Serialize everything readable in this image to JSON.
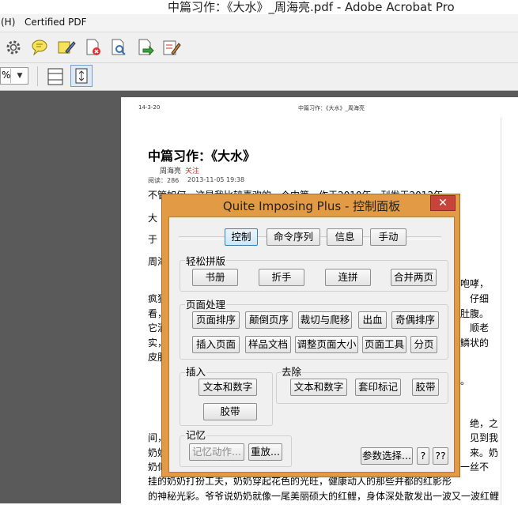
{
  "window": {
    "title": "中篇习作：《大水》_周海亮.pdf - Adobe Acrobat Pro"
  },
  "menu": {
    "items": [
      "(H)",
      "Certified PDF"
    ]
  },
  "toolbar2": {
    "zoom_suffix": "%"
  },
  "page": {
    "header_date": "14-3-20",
    "header_title": "中篇习作：《大水》_周海亮",
    "title": "中篇习作：《大水》",
    "author": "周海亮",
    "follow": "关注",
    "meta_read": "阅读：286",
    "meta_date": "2013-11-05 19:38",
    "line1": "不管如何，这是我比较喜欢的一个中篇。作于2010年，刊发于2012年",
    "frag_da": "大",
    "frag_yu": "于",
    "frag_zhou": "周海",
    "frag_feng": "疯狂",
    "frag_kan": "看，",
    "frag_ta": "它洒",
    "frag_shi": "实，",
    "frag_pi": "皮肤",
    "r1": "咆哮，",
    "r2": "仔细",
    "r3": "肚腹。",
    "r4": "顺老",
    "r5": "鳞状的",
    "r6": "。",
    "r7": "绝，之",
    "r8": "见到我",
    "r9": "来。奶",
    "r10": "一丝不",
    "frag_jian": "间，",
    "frag_nai": "奶奶",
    "frag_nai2": "奶似",
    "bottom1": "挂的奶奶打扮工夫，奶奶穿起花色的光旺，健康动人的那些并都的红影彤",
    "bottom2": "的神秘光彩。爷爷说奶奶就像一尾美丽硕大的红鲤，身体深处散发出一波又一波红鲤"
  },
  "dialog": {
    "title": "Quite Imposing Plus - 控制面板",
    "close_label": "✕",
    "tabs": [
      "控制",
      "命令序列",
      "信息",
      "手动"
    ],
    "easy_group_label": "轻松拼版",
    "easy_buttons": [
      "书册",
      "折手",
      "连拼",
      "合并两页"
    ],
    "page_group_label": "页面处理",
    "page_buttons_row1": [
      "页面排序",
      "颠倒页序",
      "裁切与爬移",
      "出血",
      "奇偶排序"
    ],
    "page_buttons_row2": [
      "插入页面",
      "样品文档",
      "调整页面大小",
      "页面工具",
      "分页"
    ],
    "insert_group_label": "插入",
    "insert_buttons": [
      "文本和数字",
      "胶带"
    ],
    "remove_group_label": "去除",
    "remove_buttons": [
      "文本和数字",
      "套印标记",
      "胶带"
    ],
    "memory_group_label": "记忆",
    "memory_buttons": [
      "记忆动作...",
      "重放..."
    ],
    "params_button": "参数选择...",
    "help_button": "?",
    "help2_button": "??"
  }
}
